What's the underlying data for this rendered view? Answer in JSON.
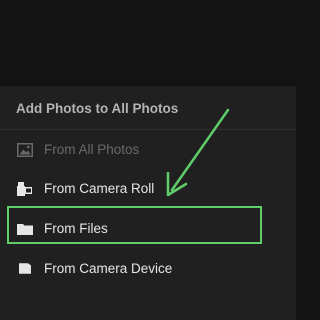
{
  "sheet": {
    "title": "Add Photos to All Photos"
  },
  "menu": {
    "items": [
      {
        "label": "From All Photos",
        "icon": "photo-icon",
        "enabled": false
      },
      {
        "label": "From Camera Roll",
        "icon": "camera-roll-icon",
        "enabled": true
      },
      {
        "label": "From Files",
        "icon": "folder-icon",
        "enabled": true
      },
      {
        "label": "From Camera Device",
        "icon": "sd-card-icon",
        "enabled": true
      }
    ]
  },
  "annotation": {
    "highlight_color": "#5fce6a",
    "highlighted_item": "From Files"
  },
  "colors": {
    "background": "#141414",
    "sheet": "#202020",
    "title": "#b4b4b4",
    "item_text": "#e6e6e6",
    "disabled_text": "#6a6a6a"
  }
}
